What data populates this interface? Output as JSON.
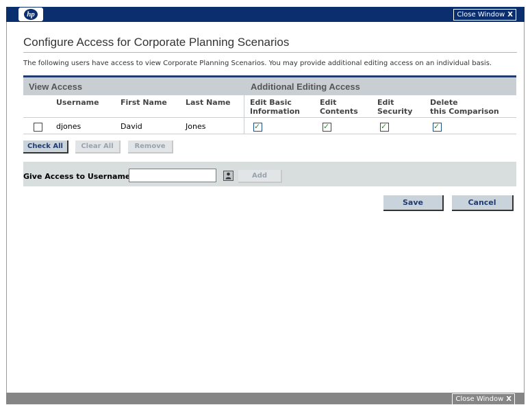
{
  "colors": {
    "header_bg": "#0b2f6e",
    "footer_bg": "#858585",
    "grid_header_bg": "#c9ced2",
    "accent_rule": "#1f3b70",
    "check_green": "#2f8a2f"
  },
  "header": {
    "logo_text": "hp",
    "close_label": "Close Window",
    "close_icon": "close-x-icon",
    "close_glyph": "X"
  },
  "footer": {
    "close_label": "Close Window",
    "close_glyph": "X"
  },
  "page": {
    "title": "Configure Access for Corporate Planning Scenarios",
    "intro": "The following users have access to view Corporate Planning Scenarios. You may provide additional editing access on an individual basis."
  },
  "grid": {
    "section_view": "View Access",
    "section_edit": "Additional Editing Access",
    "columns": {
      "username": "Username",
      "first_name": "First Name",
      "last_name": "Last Name",
      "edit_basic_1": "Edit Basic",
      "edit_basic_2": "Information",
      "edit_contents_1": "Edit",
      "edit_contents_2": "Contents",
      "edit_security_1": "Edit",
      "edit_security_2": "Security",
      "delete_1": "Delete",
      "delete_2": "this Comparison"
    },
    "rows": [
      {
        "selected": false,
        "username": "djones",
        "first_name": "David",
        "last_name": "Jones",
        "edit_basic": true,
        "edit_contents": true,
        "edit_security": true,
        "delete": true
      }
    ]
  },
  "actions": {
    "check_all": "Check All",
    "clear_all": "Clear All",
    "remove": "Remove"
  },
  "give_access": {
    "label": "Give Access to Username:",
    "value": "",
    "lookup_icon": "user-lookup-icon",
    "add": "Add"
  },
  "form_buttons": {
    "save": "Save",
    "cancel": "Cancel"
  }
}
